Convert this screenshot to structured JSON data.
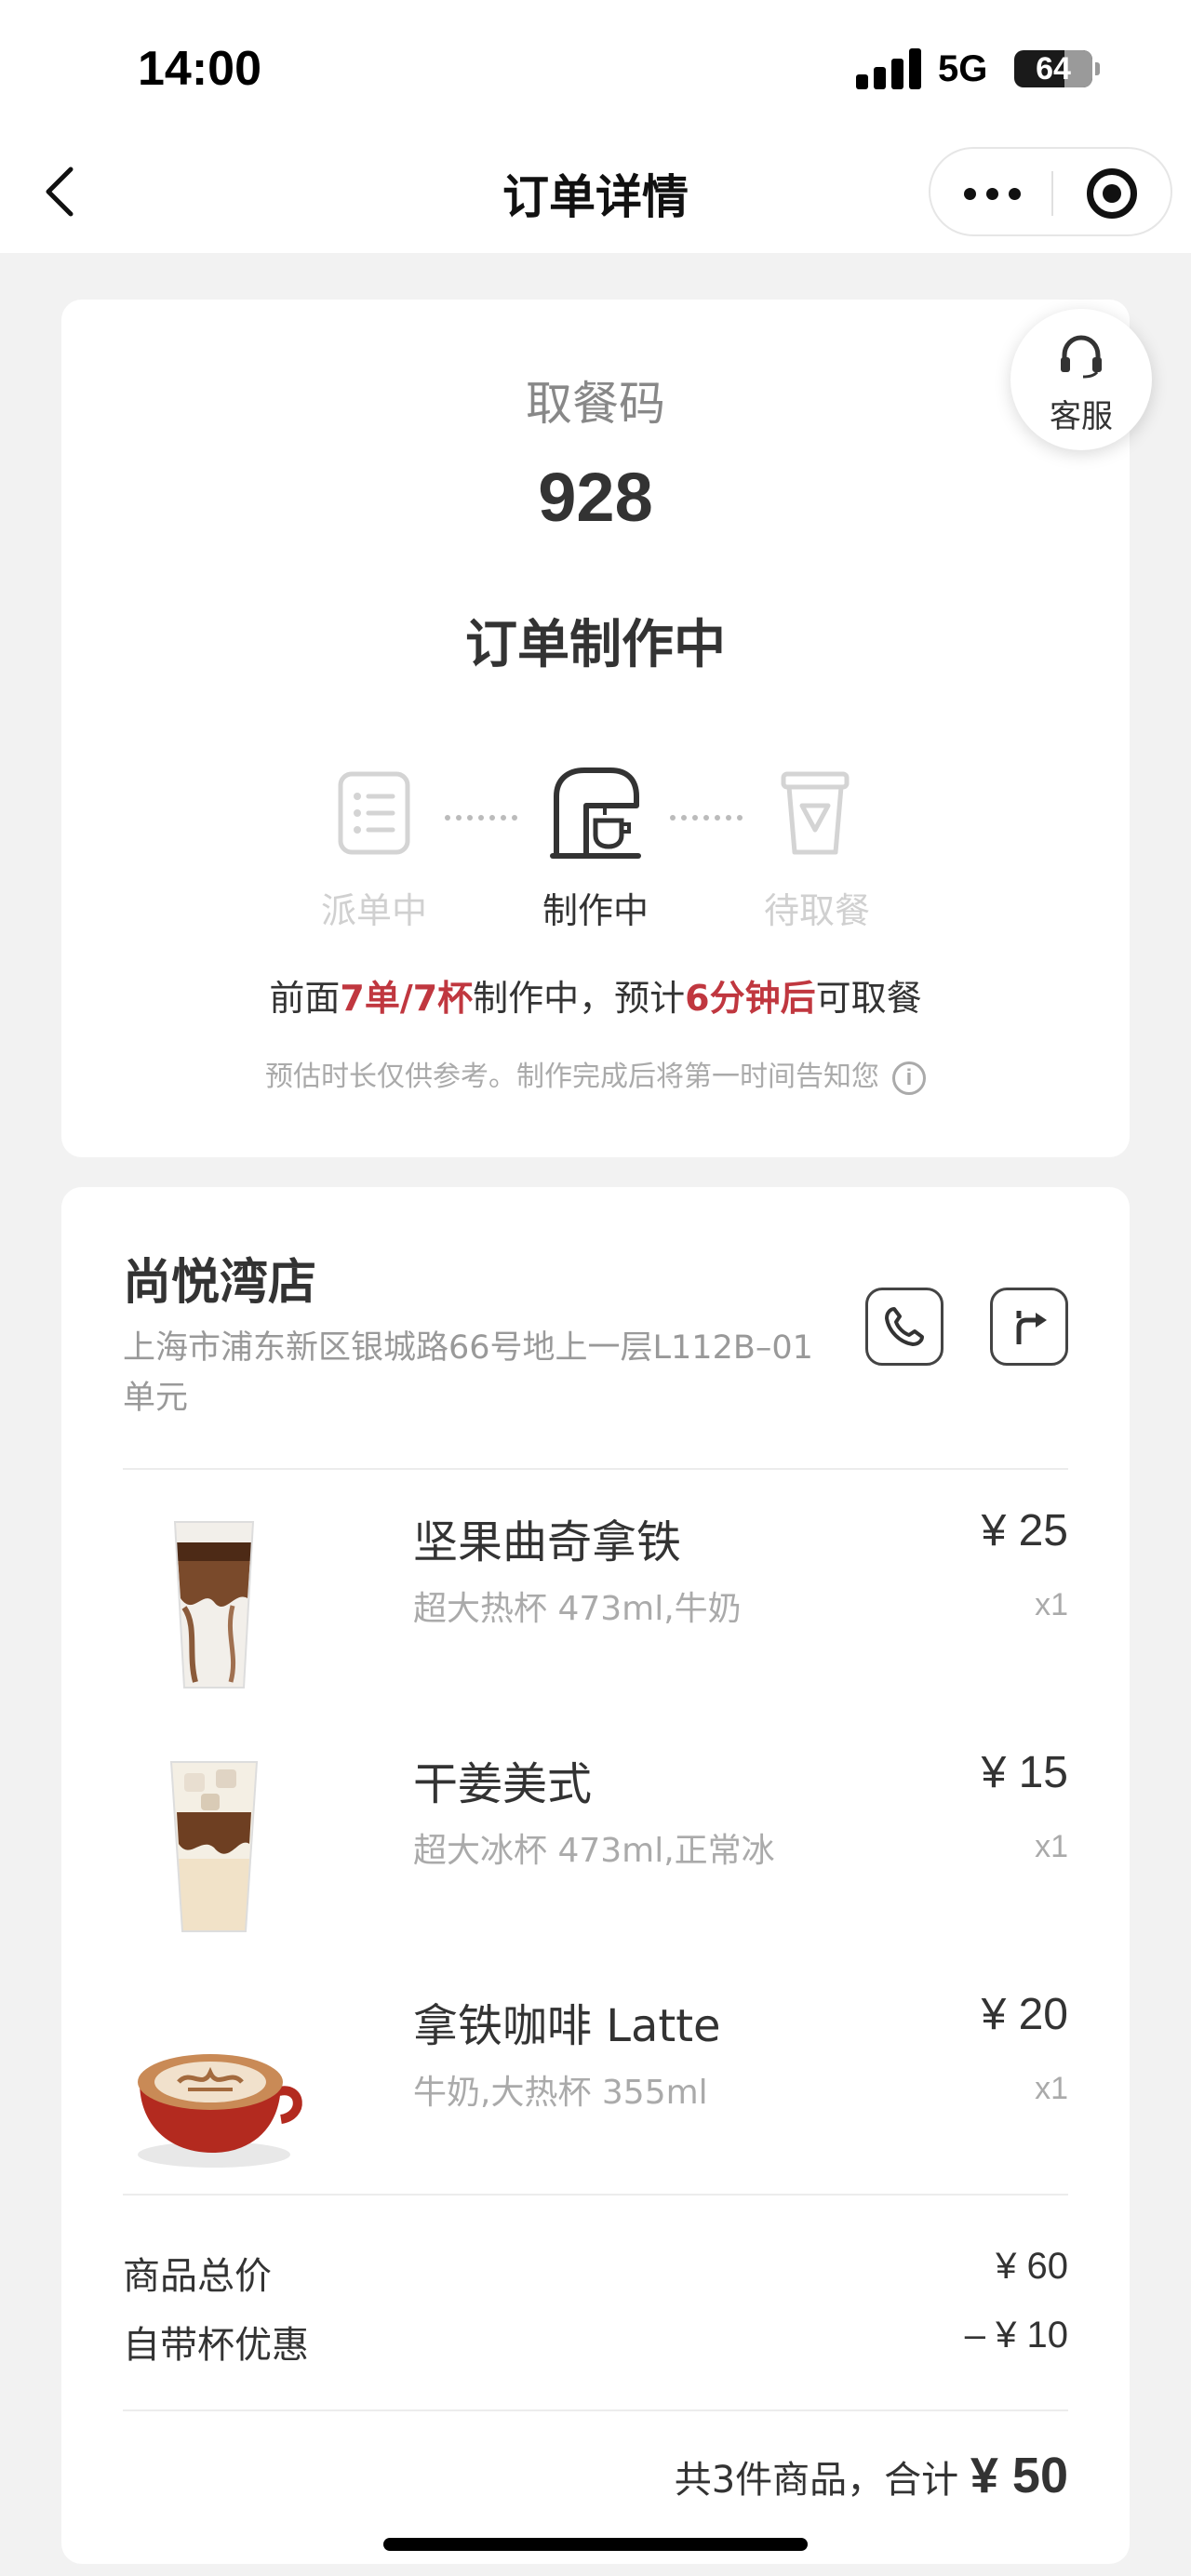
{
  "status_bar": {
    "time": "14:00",
    "network": "5G",
    "battery": "64"
  },
  "nav": {
    "title": "订单详情"
  },
  "service": {
    "label": "客服"
  },
  "order": {
    "pickup_label": "取餐码",
    "pickup_code": "928",
    "status": "订单制作中",
    "steps": [
      {
        "label": "派单中",
        "state": "done"
      },
      {
        "label": "制作中",
        "state": "active"
      },
      {
        "label": "待取餐",
        "state": "pending"
      }
    ],
    "wait": {
      "prefix": "前面",
      "queue": "7单/7杯",
      "middle": "制作中，预计",
      "eta": "6分钟后",
      "suffix": "可取餐"
    },
    "notice": "预估时长仅供参考。制作完成后将第一时间告知您",
    "info_icon": "i"
  },
  "store": {
    "name": "尚悦湾店",
    "address": "上海市浦东新区银城路66号地上一层L112B–01单元"
  },
  "items": [
    {
      "name": "坚果曲奇拿铁",
      "spec": "超大热杯 473ml,牛奶",
      "price": "¥ 25",
      "qty": "x1"
    },
    {
      "name": "干姜美式",
      "spec": "超大冰杯 473ml,正常冰",
      "price": "¥ 15",
      "qty": "x1"
    },
    {
      "name": "拿铁咖啡 Latte",
      "spec": "牛奶,大热杯 355ml",
      "price": "¥ 20",
      "qty": "x1"
    }
  ],
  "summary": {
    "subtotal_label": "商品总价",
    "subtotal": "¥ 60",
    "discount_label": "自带杯优惠",
    "discount": "–  ¥ 10",
    "total_prefix": "共3件商品，合计 ",
    "total": "¥ 50"
  },
  "colors": {
    "accent": "#c0373f",
    "muted": "#aaaaaa",
    "text": "#333333"
  }
}
